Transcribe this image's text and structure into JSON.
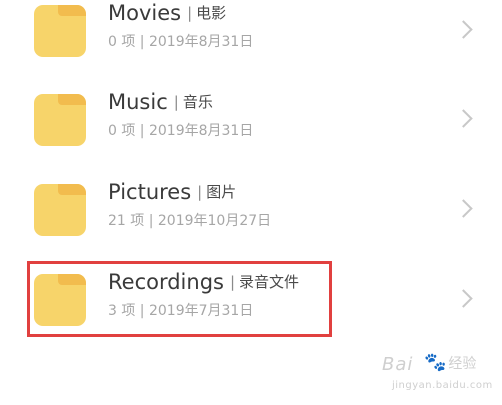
{
  "folders": [
    {
      "name": "Movies",
      "sep": "|",
      "label_zh": "电影",
      "meta": "0 项 | 2019年8月31日"
    },
    {
      "name": "Music",
      "sep": "|",
      "label_zh": "音乐",
      "meta": "0 项 | 2019年8月31日"
    },
    {
      "name": "Pictures",
      "sep": "|",
      "label_zh": "图片",
      "meta": "21 项 | 2019年10月27日"
    },
    {
      "name": "Recordings",
      "sep": "|",
      "label_zh": "录音文件",
      "meta": "3 项 | 2019年7月31日",
      "highlighted": true
    }
  ],
  "colors": {
    "folder_body": "#f7d46a",
    "folder_tab": "#f2bc4e",
    "highlight_border": "#e1403f",
    "chevron": "#c8c8c8"
  },
  "icons": {
    "folder": "folder-icon",
    "chevron": "chevron-right-icon",
    "watermark_paw": "baidu-paw-icon"
  },
  "watermark": {
    "logo_text": "Bai",
    "logo_suffix": "经验",
    "site": "jingyan.baidu.com"
  }
}
